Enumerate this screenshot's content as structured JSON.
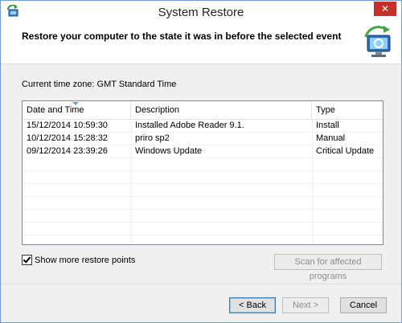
{
  "window": {
    "title": "System Restore",
    "close_label": "✕"
  },
  "header": {
    "text": "Restore your computer to the state it was in before the selected event"
  },
  "timezone": "Current time zone: GMT Standard Time",
  "table": {
    "columns": [
      "Date and Time",
      "Description",
      "Type"
    ],
    "rows": [
      [
        "15/12/2014 10:59:30",
        "Installed Adobe Reader 9.1.",
        "Install"
      ],
      [
        "10/12/2014 15:28:32",
        "priro sp2",
        "Manual"
      ],
      [
        "09/12/2014 23:39:26",
        "Windows Update",
        "Critical Update"
      ]
    ]
  },
  "options": {
    "show_more_label": "Show more restore points",
    "show_more_checked": true
  },
  "buttons": {
    "scan": "Scan for affected programs",
    "back": "< Back",
    "next": "Next >",
    "cancel": "Cancel"
  },
  "icons": {
    "app": "system-restore-icon",
    "header": "restore-computer-icon"
  },
  "colors": {
    "close": "#c7302a",
    "border": "#6d9fd4",
    "sort_arrow": "#569de5"
  }
}
